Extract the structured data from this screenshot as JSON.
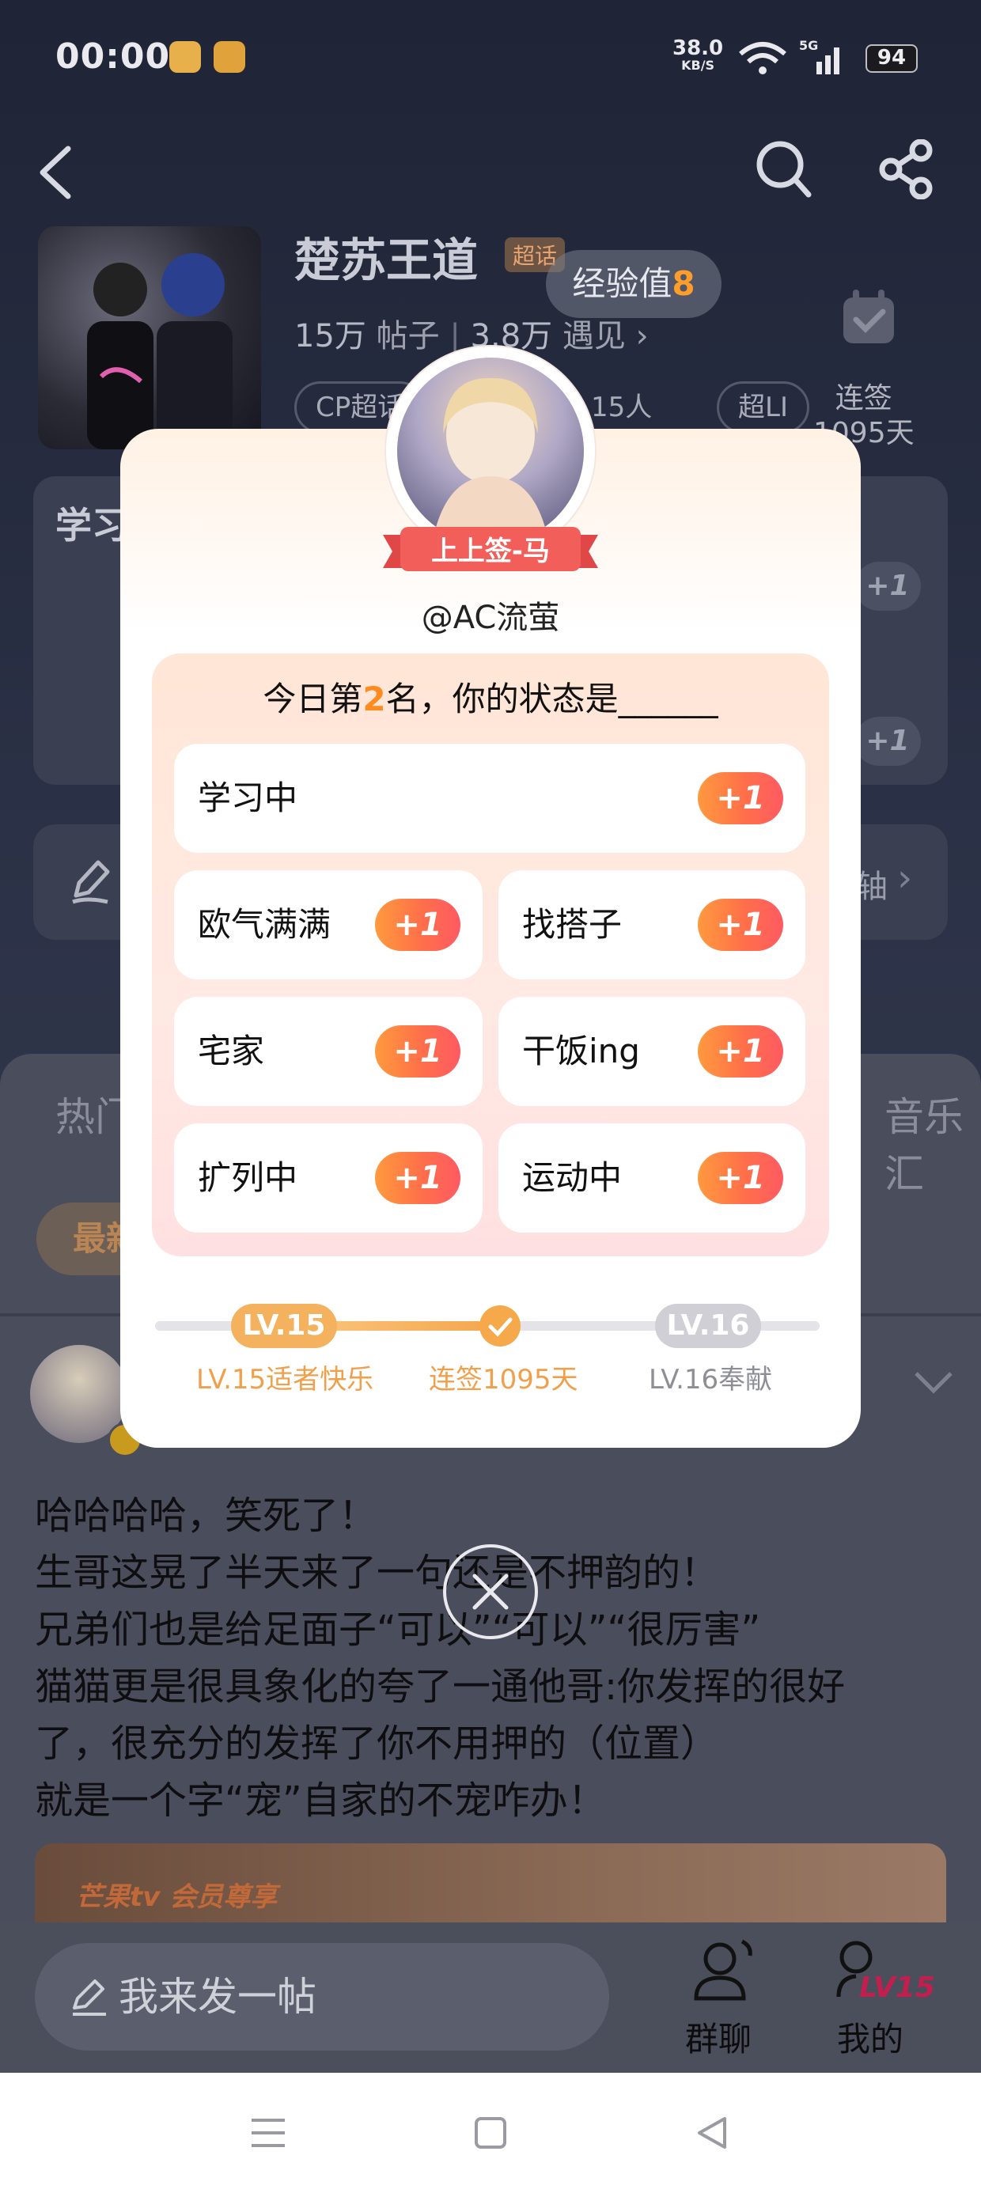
{
  "status_bar": {
    "time": "00:00",
    "net_speed_value": "38.0",
    "net_speed_unit": "KB/S",
    "signal_label": "5G",
    "battery": "94"
  },
  "header": {
    "title": "楚苏王道",
    "tag": "超话",
    "posts_count": "15万",
    "posts_label": "帖子",
    "meet_count": "3.8万",
    "meet_label": "遇见",
    "pills": [
      "CP超话",
      "15人",
      "超LI"
    ],
    "streak_label": "连签",
    "streak_days": "1095天",
    "exp_label": "经验值",
    "exp_value": "8"
  },
  "background": {
    "section_title": "学习",
    "plus_label": "+1",
    "bg_arrow_text": "轴",
    "tab_hot": "热门",
    "tab_music": "音乐汇",
    "filter_latest": "最新",
    "post_lines": [
      "哈哈哈哈，笑死了！",
      "生哥这晃了半天来了一句还是不押韵的！",
      "兄弟们也是给足面子“可以”“可以”“很厉害”",
      "猫猫更是很具象化的夸了一通他哥:你发挥的很好",
      "了，很充分的发挥了你不用押的（位置）",
      "就是一个字“宠”自家的不宠咋办！"
    ],
    "banner_text": "芒果tv 会员尊享"
  },
  "bottom_bar": {
    "compose_placeholder": "我来发一帖",
    "group_chat": "群聊",
    "mine": "我的",
    "mine_level": "LV15"
  },
  "popup": {
    "ribbon_text": "上上签-马",
    "username": "@AC流萤",
    "prompt_prefix": "今日第",
    "prompt_rank": "2",
    "prompt_suffix": "名，你的状态是______",
    "plus_label": "+1",
    "options": [
      "学习中",
      "欧气满满",
      "找搭子",
      "宅家",
      "干饭ing",
      "扩列中",
      "运动中"
    ],
    "level_current_chip": "LV.15",
    "level_next_chip": "LV.16",
    "level_current_caption": "LV.15适者快乐",
    "streak_caption": "连签1095天",
    "level_next_caption": "LV.16奉献"
  },
  "colors": {
    "accent_orange": "#ff8a1e",
    "plus_gradient_start": "#ff9a3e",
    "plus_gradient_end": "#ff5a62",
    "level_gold": "#f4a54d",
    "level_grey": "#c9c9cf"
  }
}
